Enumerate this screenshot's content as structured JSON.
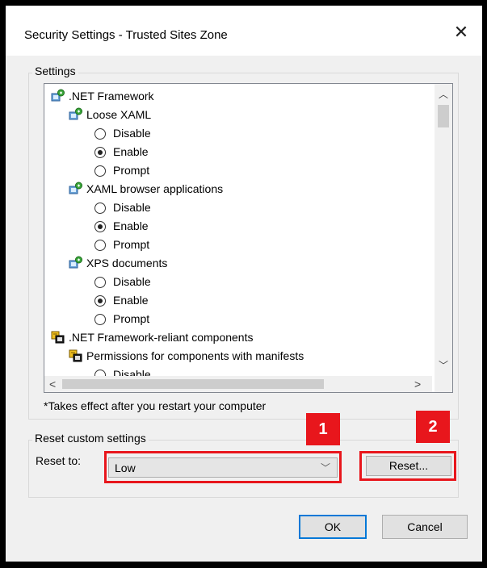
{
  "window": {
    "title": "Security Settings - Trusted Sites Zone",
    "close_glyph": "✕"
  },
  "settings": {
    "legend": "Settings",
    "tree": [
      {
        "kind": "node",
        "level": 0,
        "icon": "settings-node-icon",
        "label": ".NET Framework"
      },
      {
        "kind": "node",
        "level": 1,
        "icon": "settings-node-icon",
        "label": "Loose XAML"
      },
      {
        "kind": "radio",
        "level": 1,
        "label": "Disable",
        "selected": false
      },
      {
        "kind": "radio",
        "level": 1,
        "label": "Enable",
        "selected": true
      },
      {
        "kind": "radio",
        "level": 1,
        "label": "Prompt",
        "selected": false
      },
      {
        "kind": "node",
        "level": 1,
        "icon": "settings-node-icon",
        "label": "XAML browser applications"
      },
      {
        "kind": "radio",
        "level": 1,
        "label": "Disable",
        "selected": false
      },
      {
        "kind": "radio",
        "level": 1,
        "label": "Enable",
        "selected": true
      },
      {
        "kind": "radio",
        "level": 1,
        "label": "Prompt",
        "selected": false
      },
      {
        "kind": "node",
        "level": 1,
        "icon": "settings-node-icon",
        "label": "XPS documents"
      },
      {
        "kind": "radio",
        "level": 1,
        "label": "Disable",
        "selected": false
      },
      {
        "kind": "radio",
        "level": 1,
        "label": "Enable",
        "selected": true
      },
      {
        "kind": "radio",
        "level": 1,
        "label": "Prompt",
        "selected": false
      },
      {
        "kind": "node",
        "level": 0,
        "icon": "components-icon",
        "label": ".NET Framework-reliant components"
      },
      {
        "kind": "node",
        "level": 1,
        "icon": "components-icon",
        "label": "Permissions for components with manifests"
      },
      {
        "kind": "radio",
        "level": 1,
        "label": "Disable",
        "selected": false
      }
    ],
    "note": "*Takes effect after you restart your computer"
  },
  "reset": {
    "legend": "Reset custom settings",
    "reset_to_label": "Reset to:",
    "selected_level": "Low",
    "reset_button": "Reset..."
  },
  "footer": {
    "ok": "OK",
    "cancel": "Cancel"
  },
  "callouts": {
    "one": "1",
    "two": "2"
  },
  "colors": {
    "callout_red": "#e8161c",
    "default_button_border": "#0078d7"
  }
}
